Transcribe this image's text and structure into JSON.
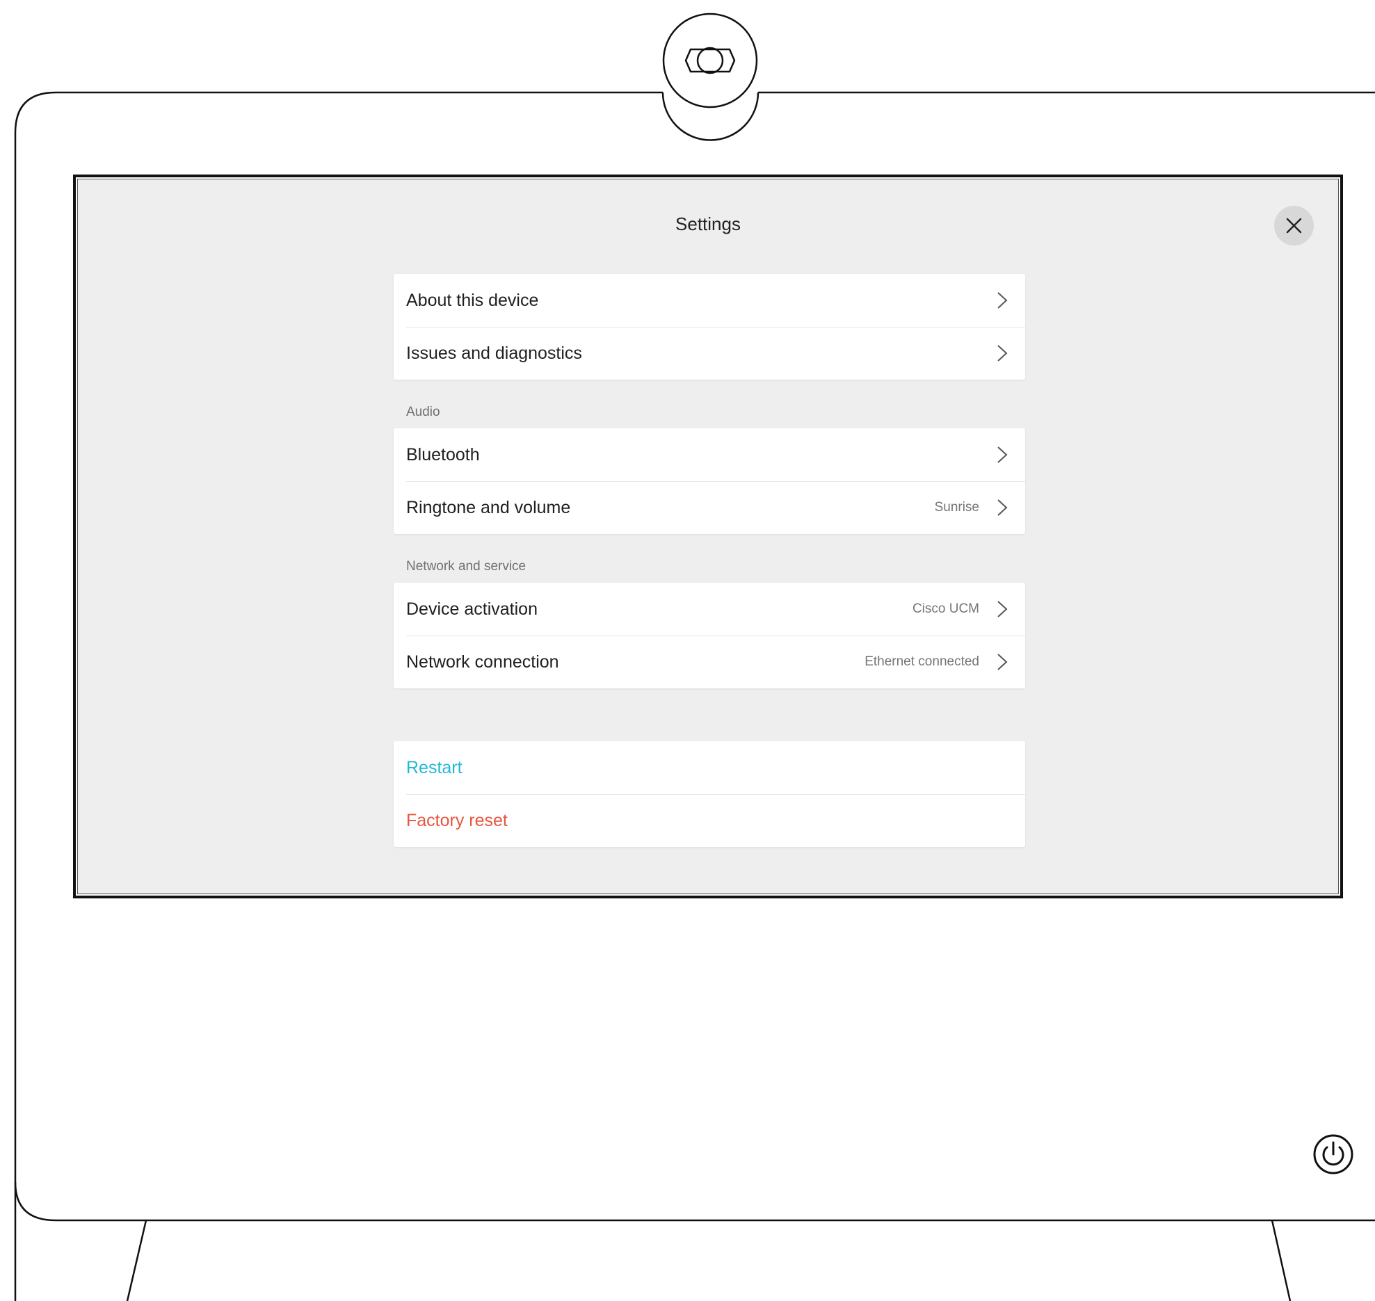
{
  "screen": {
    "title": "Settings",
    "close_icon": "close-icon"
  },
  "settings": {
    "general": [
      {
        "label": "About this device",
        "value": ""
      },
      {
        "label": "Issues and diagnostics",
        "value": ""
      }
    ],
    "audio": {
      "section_label": "Audio",
      "items": [
        {
          "label": "Bluetooth",
          "value": ""
        },
        {
          "label": "Ringtone and volume",
          "value": "Sunrise"
        }
      ]
    },
    "network": {
      "section_label": "Network and service",
      "items": [
        {
          "label": "Device activation",
          "value": "Cisco UCM"
        },
        {
          "label": "Network connection",
          "value": "Ethernet connected"
        }
      ]
    },
    "actions": {
      "restart_label": "Restart",
      "factory_reset_label": "Factory reset"
    }
  },
  "device": {
    "camera_icon": "camera-icon",
    "power_icon": "power-icon"
  },
  "colors": {
    "screen_background": "#eeeeee",
    "restart": "#21b8d6",
    "factory_reset": "#e8553f"
  }
}
